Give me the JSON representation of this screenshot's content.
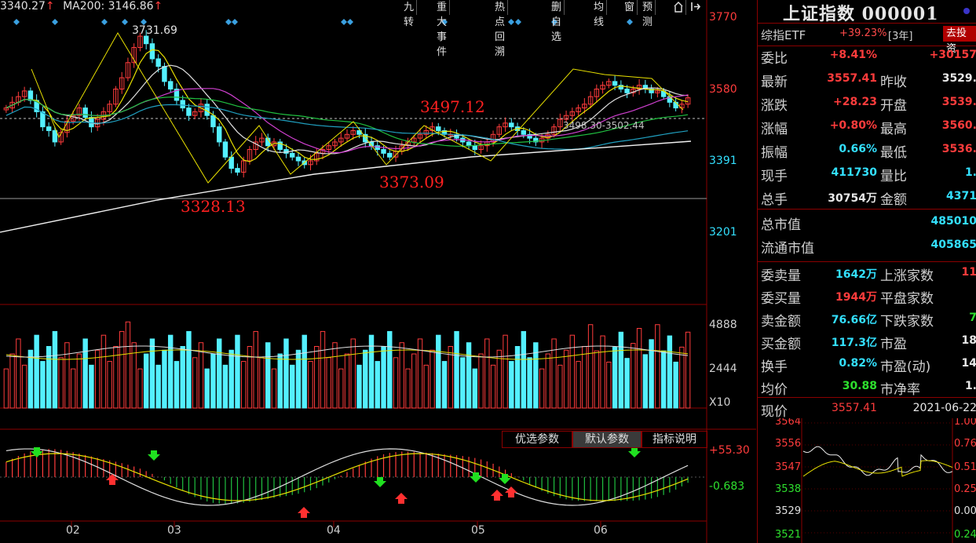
{
  "header": {
    "ma_left_value": "3340.27",
    "ma200_label": "MA200: 3146.86",
    "up_arrow": "↑"
  },
  "toolbar": {
    "items": [
      "九转",
      "重大事件",
      "热点回溯",
      "删自选",
      "均线",
      "窗",
      "预测"
    ]
  },
  "price_axis": {
    "ticks": [
      "3770",
      "3580",
      "3391",
      "3201"
    ]
  },
  "volume_axis": {
    "ticks": [
      "4888",
      "2444",
      "X10"
    ]
  },
  "indicator_axis": {
    "ticks": [
      "+55.30",
      "-0.683"
    ]
  },
  "month_labels": [
    "02",
    "03",
    "04",
    "05",
    "06"
  ],
  "annotations": {
    "high": "3731.69",
    "a1": "3497.12",
    "a2": "3373.09",
    "a3": "3328.13",
    "range": "3498.30-3502.44"
  },
  "indicator_buttons": [
    "优选参数",
    "默认参数",
    "指标说明"
  ],
  "colors": {
    "up": "#ff3c3c",
    "down": "#54f0ff",
    "ma_yellow": "#e8e000",
    "ma_white": "#e0e0e0",
    "ma_magenta": "#d040d0",
    "ma_green": "#20c040",
    "ma_cyan": "#20a0c0",
    "panel_border": "#8b0000"
  },
  "panel": {
    "title": "上证指数 000001",
    "etf_name": "综指ETF",
    "etf_value": "+39.23%",
    "etf_period": "[3年]",
    "etf_button": "去投资",
    "rows": [
      {
        "l1": "委比",
        "v1": "+8.41%",
        "c1": "red",
        "l2": "",
        "v2": "+30157",
        "c2": "red"
      },
      {
        "l1": "最新",
        "v1": "3557.41",
        "c1": "red",
        "l2": "昨收",
        "v2": "3529.",
        "c2": "white"
      },
      {
        "l1": "涨跌",
        "v1": "+28.23",
        "c1": "red",
        "l2": "开盘",
        "v2": "3539.",
        "c2": "red"
      },
      {
        "l1": "涨幅",
        "v1": "+0.80%",
        "c1": "red",
        "l2": "最高",
        "v2": "3560.",
        "c2": "red"
      },
      {
        "l1": "振幅",
        "v1": "0.66%",
        "c1": "cyan",
        "l2": "最低",
        "v2": "3536.",
        "c2": "red"
      },
      {
        "l1": "现手",
        "v1": "411730",
        "c1": "cyan",
        "l2": "量比",
        "v2": "1.",
        "c2": "cyan"
      },
      {
        "l1": "总手",
        "v1": "30754万",
        "c1": "white",
        "l2": "金额",
        "v2": "4371",
        "c2": "cyan"
      }
    ],
    "mkt": [
      {
        "l1": "总市值",
        "v2": "485010"
      },
      {
        "l1": "流通市值",
        "v2": "405865"
      }
    ],
    "rows2": [
      {
        "l1": "委卖量",
        "v1": "1642万",
        "c1": "cyan",
        "l2": "上涨家数",
        "v2": "11",
        "c2": "red"
      },
      {
        "l1": "委买量",
        "v1": "1944万",
        "c1": "red",
        "l2": "平盘家数",
        "v2": "",
        "c2": "white"
      },
      {
        "l1": "卖金额",
        "v1": "76.66亿",
        "c1": "cyan",
        "l2": "下跌家数",
        "v2": "7",
        "c2": "green"
      },
      {
        "l1": "买金额",
        "v1": "117.3亿",
        "c1": "cyan",
        "l2": "市盈",
        "v2": "18",
        "c2": "white"
      },
      {
        "l1": "换手",
        "v1": "0.82%",
        "c1": "cyan",
        "l2": "市盈(动)",
        "v2": "14",
        "c2": "white"
      },
      {
        "l1": "均价",
        "v1": "30.88",
        "c1": "green",
        "l2": "市净率",
        "v2": "1.",
        "c2": "white"
      }
    ],
    "now_label": "现价",
    "now_value": "3557.41",
    "date": "2021-06-22",
    "mini_left_ticks": [
      "3564",
      "3556",
      "3547",
      "3538",
      "3529",
      "3521"
    ],
    "mini_right_ticks": [
      "1.00",
      "0.76",
      "0.51",
      "0.25",
      "0.00",
      "0.24"
    ]
  }
}
